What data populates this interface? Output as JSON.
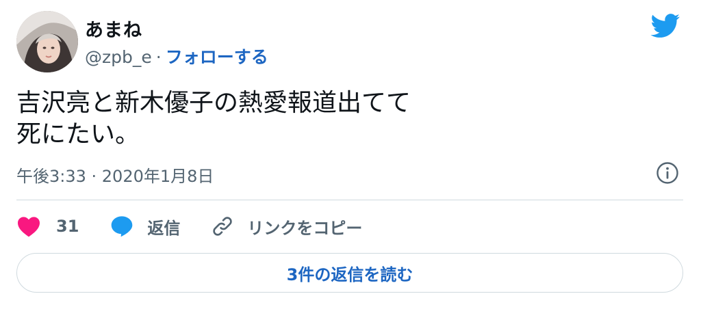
{
  "user": {
    "display_name": "あまね",
    "handle": "@zpb_e",
    "separator": "·",
    "follow_label": "フォローする"
  },
  "tweet": {
    "text_line1": "吉沢亮と新木優子の熱愛報道出てて",
    "text_line2": "死にたい。",
    "timestamp": "午後3:33 · 2020年1月8日"
  },
  "actions": {
    "like_count": "31",
    "reply_label": "返信",
    "copy_link_label": "リンクをコピー"
  },
  "read_replies_label": "3件の返信を読む",
  "icons": {
    "brand": "twitter-bird-icon",
    "like": "heart-icon",
    "reply": "speech-bubble-icon",
    "copy_link": "link-icon",
    "info": "info-icon"
  },
  "colors": {
    "twitter_blue": "#1d9bf0",
    "link_blue": "#1d66c2",
    "like_pink": "#f91880",
    "muted_text": "#536471",
    "border": "#cfd9de"
  }
}
